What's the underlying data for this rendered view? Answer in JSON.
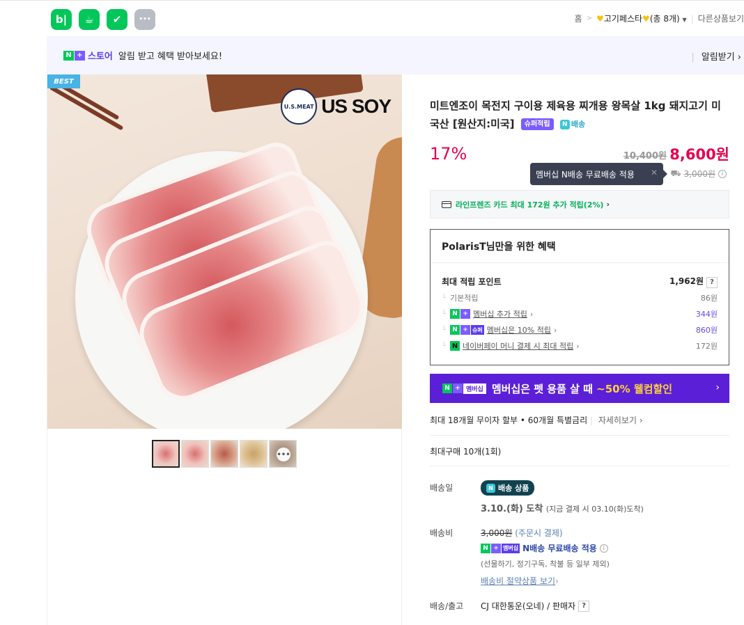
{
  "apps": [
    {
      "name": "blog",
      "glyph": "b|"
    },
    {
      "name": "cafe",
      "glyph": "☕"
    },
    {
      "name": "bookmark",
      "glyph": "✔"
    },
    {
      "name": "more",
      "glyph": "•••"
    }
  ],
  "breadcrumb": {
    "home": "홈",
    "sep": ">",
    "current": "고기페스타",
    "count": "(총 8개)",
    "other": "다른상품보기"
  },
  "notice": {
    "store_label": "스토어",
    "text": "알림 받고 혜택 받아보세요!",
    "action": "알림받기"
  },
  "gallery": {
    "badge": "BEST",
    "logo_circle": "U.S.MEAT",
    "logo_text": "US SOY",
    "more_glyph": "•••"
  },
  "product": {
    "title": "미트엔조이 목전지 구이용 제육용 찌개용 왕목살 1kg 돼지고기 미국산 [원산지:미국]",
    "badge_super": "슈퍼적립",
    "badge_delivery": "배송",
    "discount": "17%",
    "original_price": "10,400원",
    "final_price": "8,600원",
    "tooltip": "멤버십 N배송 무료배송 적용",
    "shipping_original": "3,000원"
  },
  "card_promo": "라인프렌즈 카드 최대 172원 추가 적립(2%)",
  "benefit": {
    "heading": "PolarisT님만을 위한 혜택",
    "max_label": "최대 적립 포인트",
    "max_value": "1,962원",
    "rows": [
      {
        "label": "기본적립",
        "value": "86원"
      },
      {
        "label": "멤버십 추가 적립",
        "value": "344원"
      },
      {
        "label": "멤버십은 10% 적립",
        "value": "860원"
      },
      {
        "label": "네이버페이 머니 결제 시 최대 적립",
        "value": "172원"
      }
    ]
  },
  "banner": {
    "mb": "멤버십",
    "text_a": "멤버십은 펫 용품 살 때 ",
    "text_b": "~50% 웰컴할인"
  },
  "installment": {
    "text": "최대 18개월 무이자 할부 • 60개월 특별금리",
    "more": "자세히보기"
  },
  "max_buy": "최대구매 10개(1회)",
  "delivery": {
    "date_label": "배송일",
    "pill": "배송 상품",
    "arrive": "3.10.(화) 도착",
    "arrive_note": "(지금 결제 시 03.10(화)도착)",
    "fee_label": "배송비",
    "fee_strike": "3,000원",
    "fee_note": "(주문시 결제)",
    "fee_membership": "멤버십",
    "fee_free": "N배송 무료배송 적용",
    "fee_exclude": "(선물하기, 정기구독, 착불 등 일부 제외)",
    "fee_link": "배송비 절약상품 보기",
    "ship_label": "배송/출고",
    "ship_value": "CJ 대한통운(오네) / 판매자"
  }
}
